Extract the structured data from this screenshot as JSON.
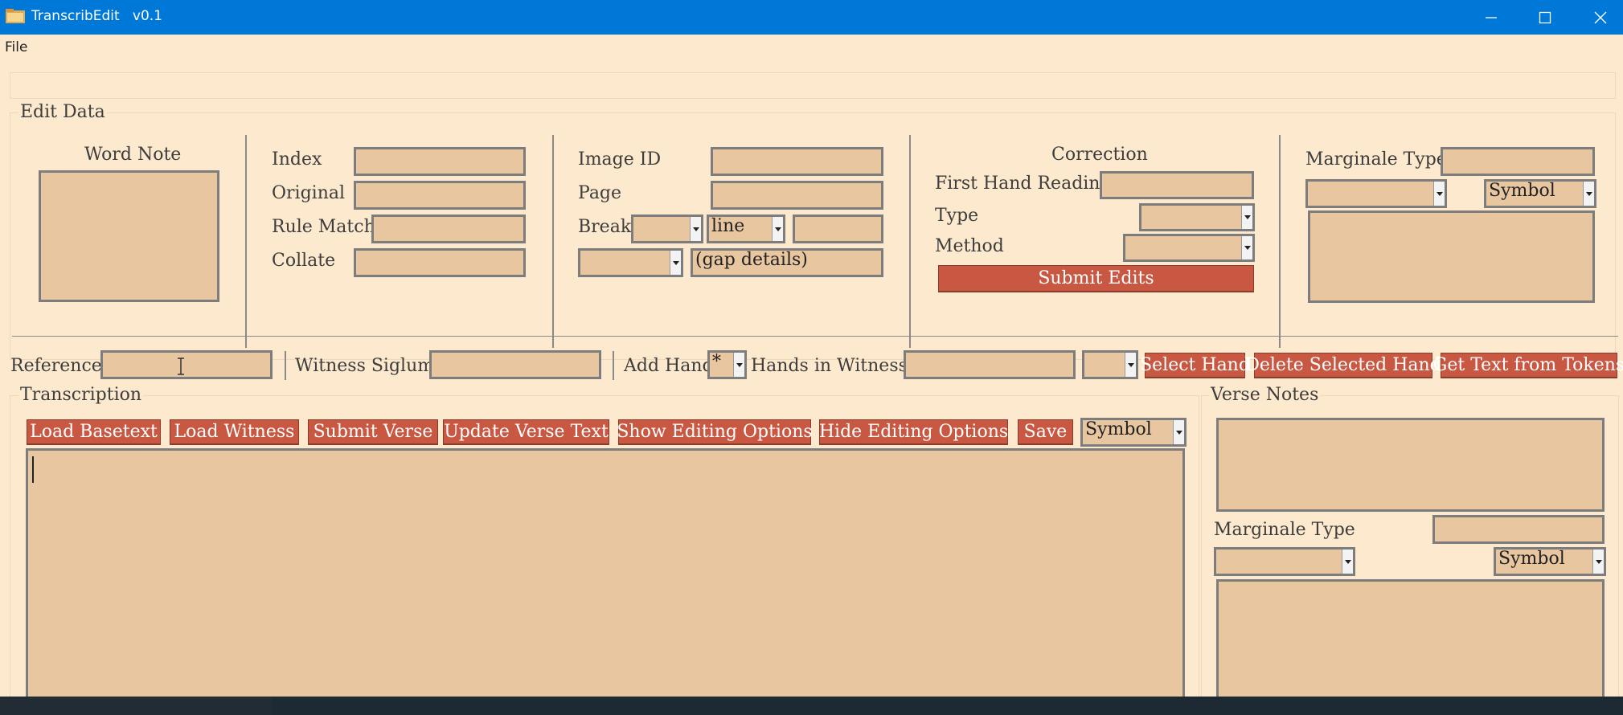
{
  "window": {
    "title": "TranscribEdit   v0.1"
  },
  "menu": {
    "file": "File"
  },
  "edit_data": {
    "title": "Edit Data",
    "word_note": "Word Note",
    "index": "Index",
    "original": "Original",
    "rule_match": "Rule Match",
    "collate": "Collate",
    "image_id": "Image ID",
    "page": "Page",
    "break": "Break",
    "break_type": "line",
    "gap_details": "(gap details)",
    "correction": "Correction",
    "first_hand_reading": "First Hand Reading",
    "type": "Type",
    "method": "Method",
    "submit_edits": "Submit Edits",
    "marginale_type": "Marginale Type",
    "symbol": "Symbol"
  },
  "toolbar": {
    "reference": "Reference",
    "witness_siglum": "Witness Siglum",
    "add_hand": "Add Hand",
    "add_hand_value": "*",
    "hands_in_witness": "Hands in Witness:",
    "select_hand": "Select Hand",
    "delete_selected_hand": "Delete Selected Hand",
    "get_text_from_tokens": "Get Text from Tokens"
  },
  "transcription": {
    "title": "Transcription",
    "buttons": [
      "Load Basetext",
      "Load Witness",
      "Submit Verse",
      "Update Verse Text",
      "Show Editing Options",
      "Hide Editing Options",
      "Save"
    ],
    "symbol": "Symbol"
  },
  "verse_notes": {
    "title": "Verse Notes",
    "marginale_type": "Marginale Type",
    "symbol": "Symbol"
  }
}
